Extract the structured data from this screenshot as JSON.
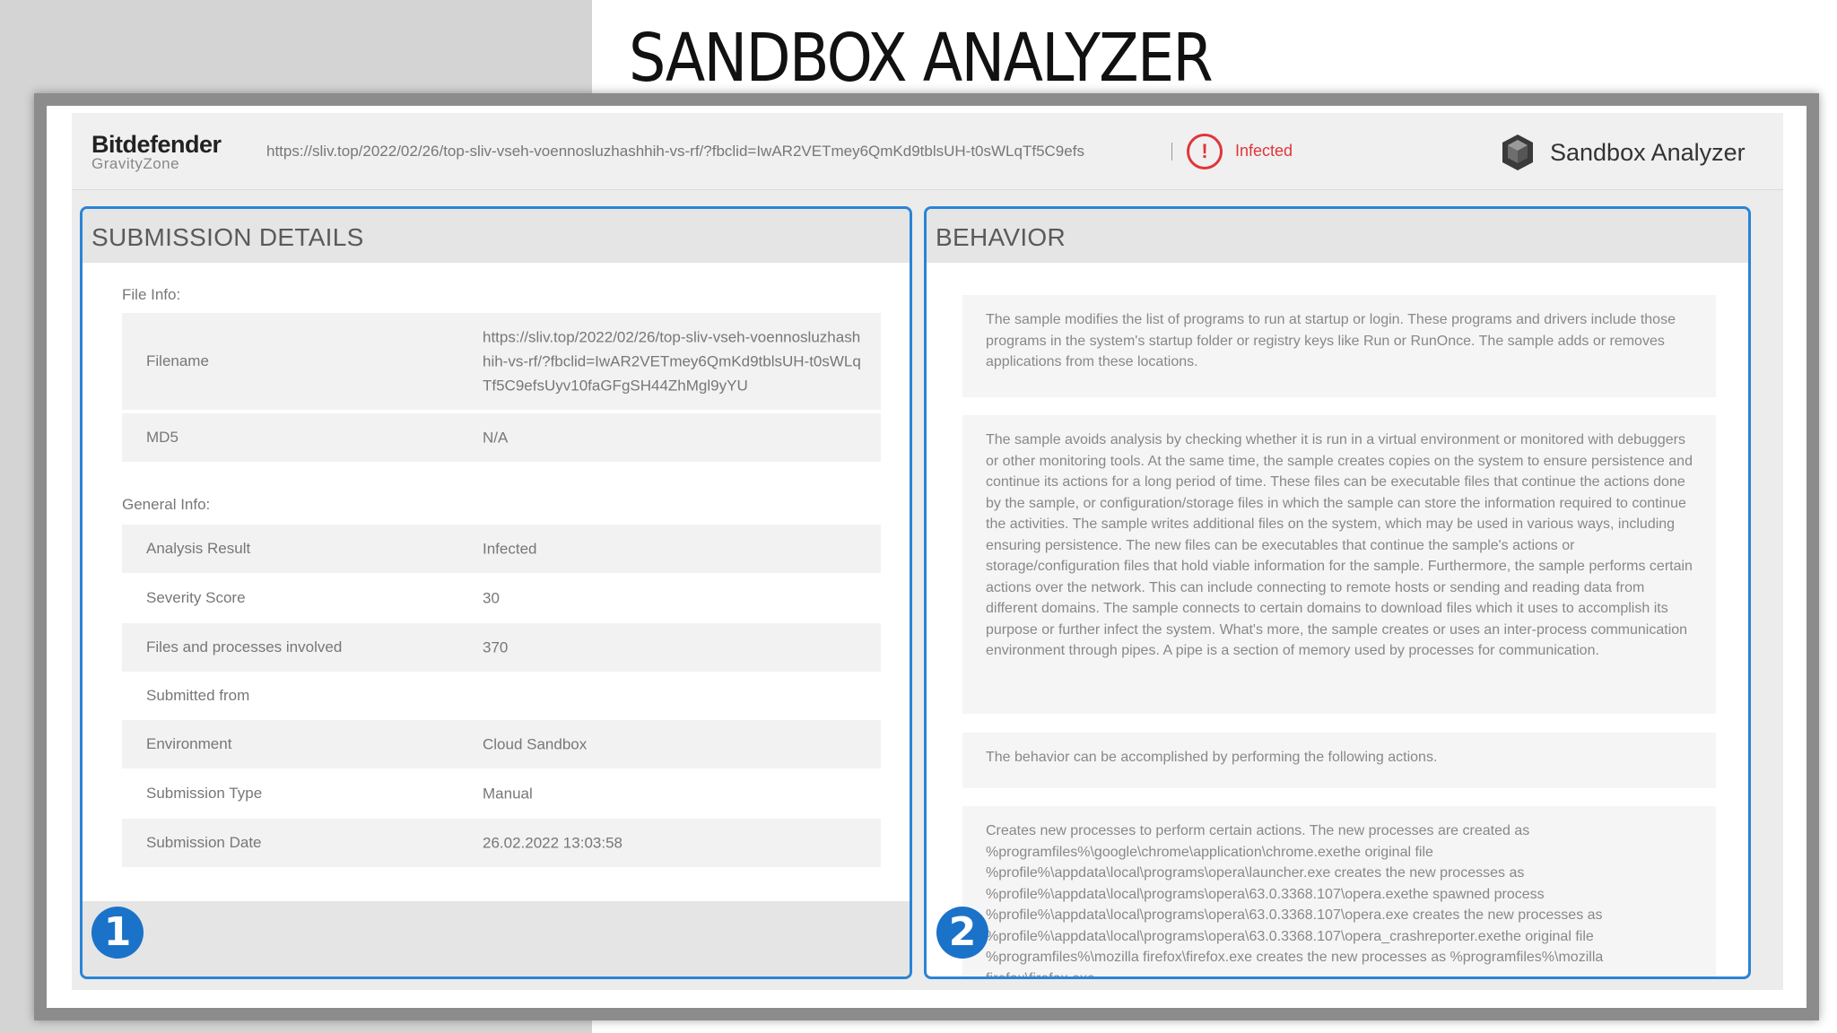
{
  "slide": {
    "title": "SANDBOX ANALYZER"
  },
  "header": {
    "brand": "Bitdefender",
    "brand_sub": "GravityZone",
    "url": "https://sliv.top/2022/02/26/top-sliv-vseh-voennosluzhashhih-vs-rf/?fbclid=IwAR2VETmey6QmKd9tblsUH-t0sWLqTf5C9efs",
    "status": "Infected",
    "status_color": "#e0353a",
    "product_icon": "sandbox-cube-icon",
    "product": "Sandbox Analyzer"
  },
  "submission": {
    "title": "SUBMISSION DETAILS",
    "file_info_label": "File Info:",
    "file_info": [
      {
        "key": "Filename",
        "value": "https://sliv.top/2022/02/26/top-sliv-vseh-voennosluzhashhih-vs-rf/?fbclid=IwAR2VETmey6QmKd9tblsUH-t0sWLqTf5C9efsUyv10faGFgSH44ZhMgl9yYU"
      },
      {
        "key": "MD5",
        "value": "N/A"
      }
    ],
    "general_info_label": "General Info:",
    "general_info": [
      {
        "key": "Analysis Result",
        "value": "Infected"
      },
      {
        "key": "Severity Score",
        "value": "30"
      },
      {
        "key": "Files and processes involved",
        "value": "370"
      },
      {
        "key": "Submitted from",
        "value": ""
      },
      {
        "key": "Environment",
        "value": "Cloud Sandbox"
      },
      {
        "key": "Submission Type",
        "value": "Manual"
      },
      {
        "key": "Submission Date",
        "value": "26.02.2022 13:03:58"
      }
    ],
    "badge": "1"
  },
  "behavior": {
    "title": "BEHAVIOR",
    "paragraphs": [
      "The sample modifies the list of programs to run at startup or login. These programs and drivers include those programs in the system's startup folder or registry keys like Run or RunOnce. The sample adds or removes applications from these locations.",
      "The sample avoids analysis by checking whether it is run in a virtual environment or monitored with debuggers or other monitoring tools. At the same time, the sample creates copies on the system to ensure persistence and continue its actions for a long period of time. These files can be executable files that continue the actions done by the sample, or configuration/storage files in which the sample can store the information required to continue the activities. The sample writes additional files on the system, which may be used in various ways, including ensuring persistence. The new files can be executables that continue the sample's actions or storage/configuration files that hold viable information for the sample. Furthermore, the sample performs certain actions over the network. This can include connecting to remote hosts or sending and reading data from different domains. The sample connects to certain domains to download files which it uses to accomplish its purpose or further infect the system. What's more, the sample creates or uses an inter-process communication environment through pipes. A pipe is a section of memory used by processes for communication.",
      "The behavior can be accomplished by performing the following actions.",
      "Creates new processes to perform certain actions. The new processes are created as %programfiles%\\google\\chrome\\application\\chrome.exethe original file %profile%\\appdata\\local\\programs\\opera\\launcher.exe creates the new processes as %profile%\\appdata\\local\\programs\\opera\\63.0.3368.107\\opera.exethe spawned process %profile%\\appdata\\local\\programs\\opera\\63.0.3368.107\\opera.exe creates the new processes as %profile%\\appdata\\local\\programs\\opera\\63.0.3368.107\\opera_crashreporter.exethe original file %programfiles%\\mozilla firefox\\firefox.exe creates the new processes as %programfiles%\\mozilla firefox\\firefox.exe"
    ],
    "badge": "2"
  },
  "colors": {
    "accent_border": "#2a84d6",
    "badge": "#1a73c9"
  }
}
